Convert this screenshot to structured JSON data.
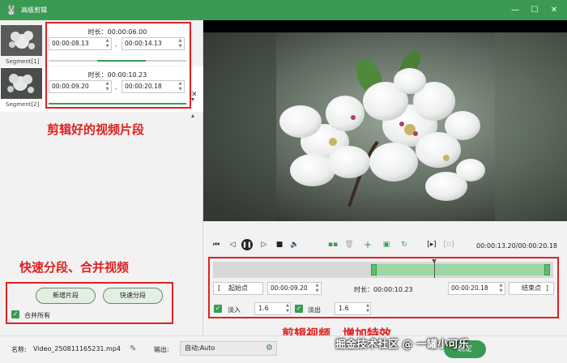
{
  "window": {
    "title": "高级剪辑",
    "app_icon": "rabbit-icon",
    "controls": [
      "minimize-icon",
      "maximize-icon",
      "close-icon"
    ]
  },
  "segments": [
    {
      "label": "Segment[1]",
      "duration": "时长：00:00:06.00",
      "start": "00:00:08.13",
      "end": "00:00:14.13"
    },
    {
      "label": "Segment[2]",
      "duration": "时长：00:00:10.23",
      "start": "00:00:09.20",
      "end": "00:00:20.18"
    }
  ],
  "segment_separator": "-",
  "annotations": {
    "segments": "剪辑好的视频片段",
    "split_merge": "快速分段、合并视频",
    "edit_effects": "剪辑视频、增加特效"
  },
  "split_panel": {
    "new_segment": "新增片段",
    "quick_split": "快速分段",
    "merge_all": "合并所有",
    "merge_all_checked": true
  },
  "playback": {
    "time": "00:00:13.20/00:00:20.18",
    "icons": [
      "skip-start-icon",
      "step-back-icon",
      "pause-icon",
      "step-forward-icon",
      "stop-icon",
      "volume-icon",
      "split-icon",
      "delete-icon",
      "add-icon",
      "copy-icon",
      "rotate-icon",
      "crop-icon",
      "aspect-icon"
    ]
  },
  "edit": {
    "start_button": "起始点",
    "start_value": "00:00:09.20",
    "duration": "时长：00:00:10.23",
    "end_value": "00:00:20.18",
    "end_button": "结束点",
    "fade_in_label": "淡入",
    "fade_in_value": "1.6",
    "fade_in_checked": true,
    "fade_out_label": "淡出",
    "fade_out_value": "1.6",
    "fade_out_checked": true,
    "range_start_fraction": 0.47,
    "range_end_fraction": 0.985,
    "playhead_fraction": 0.651
  },
  "bottom": {
    "name_label": "名称:",
    "name_value": "Video_250811165231.mp4",
    "output_label": "输出:",
    "output_value": "自动;Auto",
    "ok_button": "确定"
  },
  "watermark": "掘金技术社区 @ 一罐小可乐",
  "colors": {
    "accent": "#3a9a54",
    "annotation_red": "#e02020",
    "timeline_range": "#9bd6a4"
  }
}
